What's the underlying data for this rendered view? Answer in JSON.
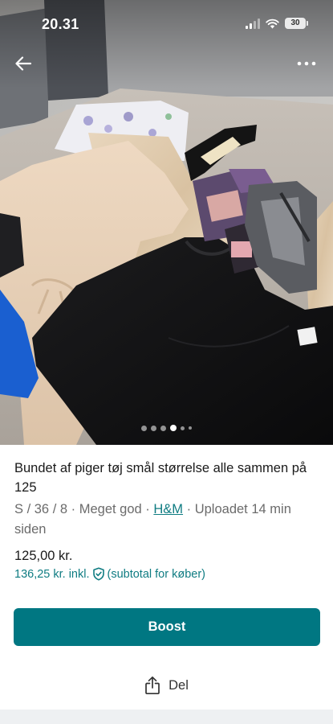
{
  "status_bar": {
    "time": "20.31",
    "battery": "30"
  },
  "navigation": {
    "back_icon": "arrow-left-icon",
    "more_icon": "more-horizontal-icon"
  },
  "gallery": {
    "image_count": 6,
    "active_index": 3
  },
  "listing": {
    "title": "Bundet af piger tøj smål størrelse  alle sammen på 125",
    "size": "S / 36 / 8",
    "separator": " · ",
    "condition": "Meget god",
    "brand": "H&M",
    "uploaded": "Uploadet 14 min siden"
  },
  "pricing": {
    "price": "125,00 kr.",
    "incl_price": "136,25 kr. inkl.",
    "incl_note": "(subtotal for køber)",
    "shield_icon": "shield-check-icon"
  },
  "actions": {
    "boost_label": "Boost",
    "share_label": "Del",
    "share_icon": "share-icon"
  },
  "colors": {
    "accent": "#007782",
    "link": "#0f7c82",
    "muted_text": "#6b6b6b"
  }
}
